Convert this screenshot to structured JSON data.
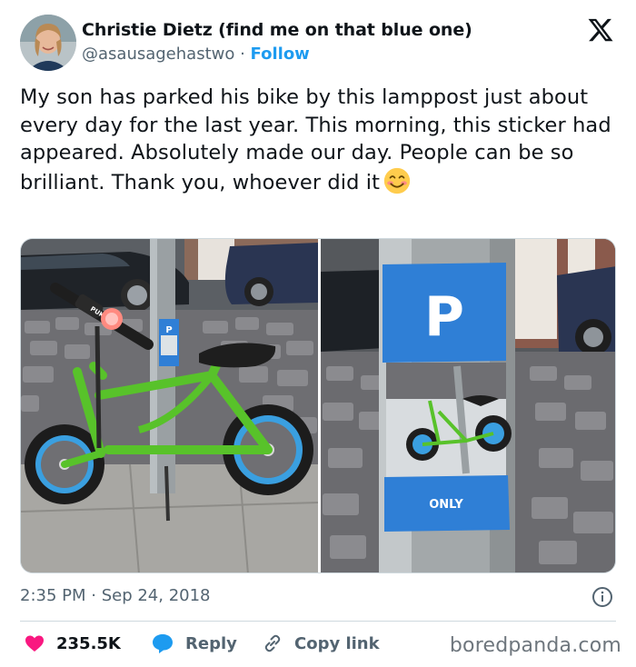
{
  "author": {
    "display_name": "Christie Dietz (find me on that blue one)",
    "handle": "@asausagehastwo",
    "separator": " · ",
    "follow_label": "Follow"
  },
  "tweet": {
    "text": "My son has parked his bike by this lamppost just about every day for the last year. This morning, this sticker had appeared. Absolutely made our day. People can be so brilliant. Thank you, whoever did it",
    "emoji": "smiling-face-emoji"
  },
  "media": {
    "photo1": {
      "subject": "green balance bike parked by lamppost",
      "bike_brand": "PUKY",
      "sticker_top": "P",
      "sticker_bottom": ""
    },
    "photo2": {
      "subject": "close-up of bike parking sticker on lamppost",
      "sticker_top": "P",
      "sticker_bottom": "ONLY"
    }
  },
  "meta": {
    "timestamp": "2:35 PM · Sep 24, 2018"
  },
  "actions": {
    "like_count": "235.5K",
    "reply_label": "Reply",
    "copy_label": "Copy link"
  },
  "watermark": "boredpanda.com",
  "colors": {
    "accent": "#1d9bf0",
    "like": "#f91880",
    "text": "#0f1419",
    "secondary": "#536471",
    "sticker_blue": "#2f7fd6",
    "bike_green": "#58c22a"
  }
}
